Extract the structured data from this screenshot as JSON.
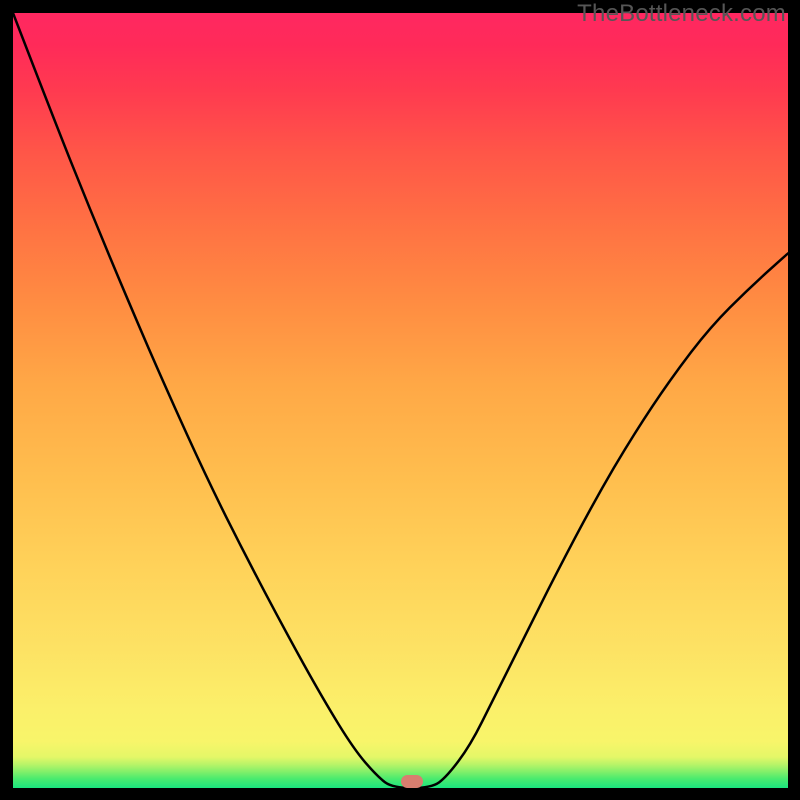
{
  "watermark": "TheBottleneck.com",
  "marker": {
    "cx_frac": 0.515,
    "cy_frac": 0.992
  },
  "chart_data": {
    "type": "line",
    "title": "",
    "xlabel": "",
    "ylabel": "",
    "xlim": [
      0,
      1
    ],
    "ylim": [
      0,
      1
    ],
    "series": [
      {
        "name": "curve",
        "x": [
          0.0,
          0.05,
          0.1,
          0.15,
          0.2,
          0.25,
          0.3,
          0.35,
          0.4,
          0.44,
          0.47,
          0.49,
          0.54,
          0.56,
          0.59,
          0.62,
          0.66,
          0.7,
          0.75,
          0.8,
          0.85,
          0.9,
          0.95,
          1.0
        ],
        "y": [
          1.0,
          0.87,
          0.745,
          0.625,
          0.51,
          0.4,
          0.3,
          0.205,
          0.115,
          0.05,
          0.015,
          0.0,
          0.0,
          0.015,
          0.055,
          0.115,
          0.195,
          0.275,
          0.37,
          0.455,
          0.53,
          0.595,
          0.645,
          0.69
        ]
      }
    ],
    "annotations": [
      {
        "type": "marker",
        "x": 0.515,
        "y": 0.008,
        "shape": "pill",
        "color": "#D87E6F"
      }
    ],
    "background_gradient": {
      "direction": "vertical",
      "stops": [
        {
          "pos": 0.0,
          "color": "#FF2861"
        },
        {
          "pos": 0.5,
          "color": "#FFBE4E"
        },
        {
          "pos": 0.92,
          "color": "#F8F56A"
        },
        {
          "pos": 1.0,
          "color": "#1BE57F"
        }
      ]
    }
  }
}
